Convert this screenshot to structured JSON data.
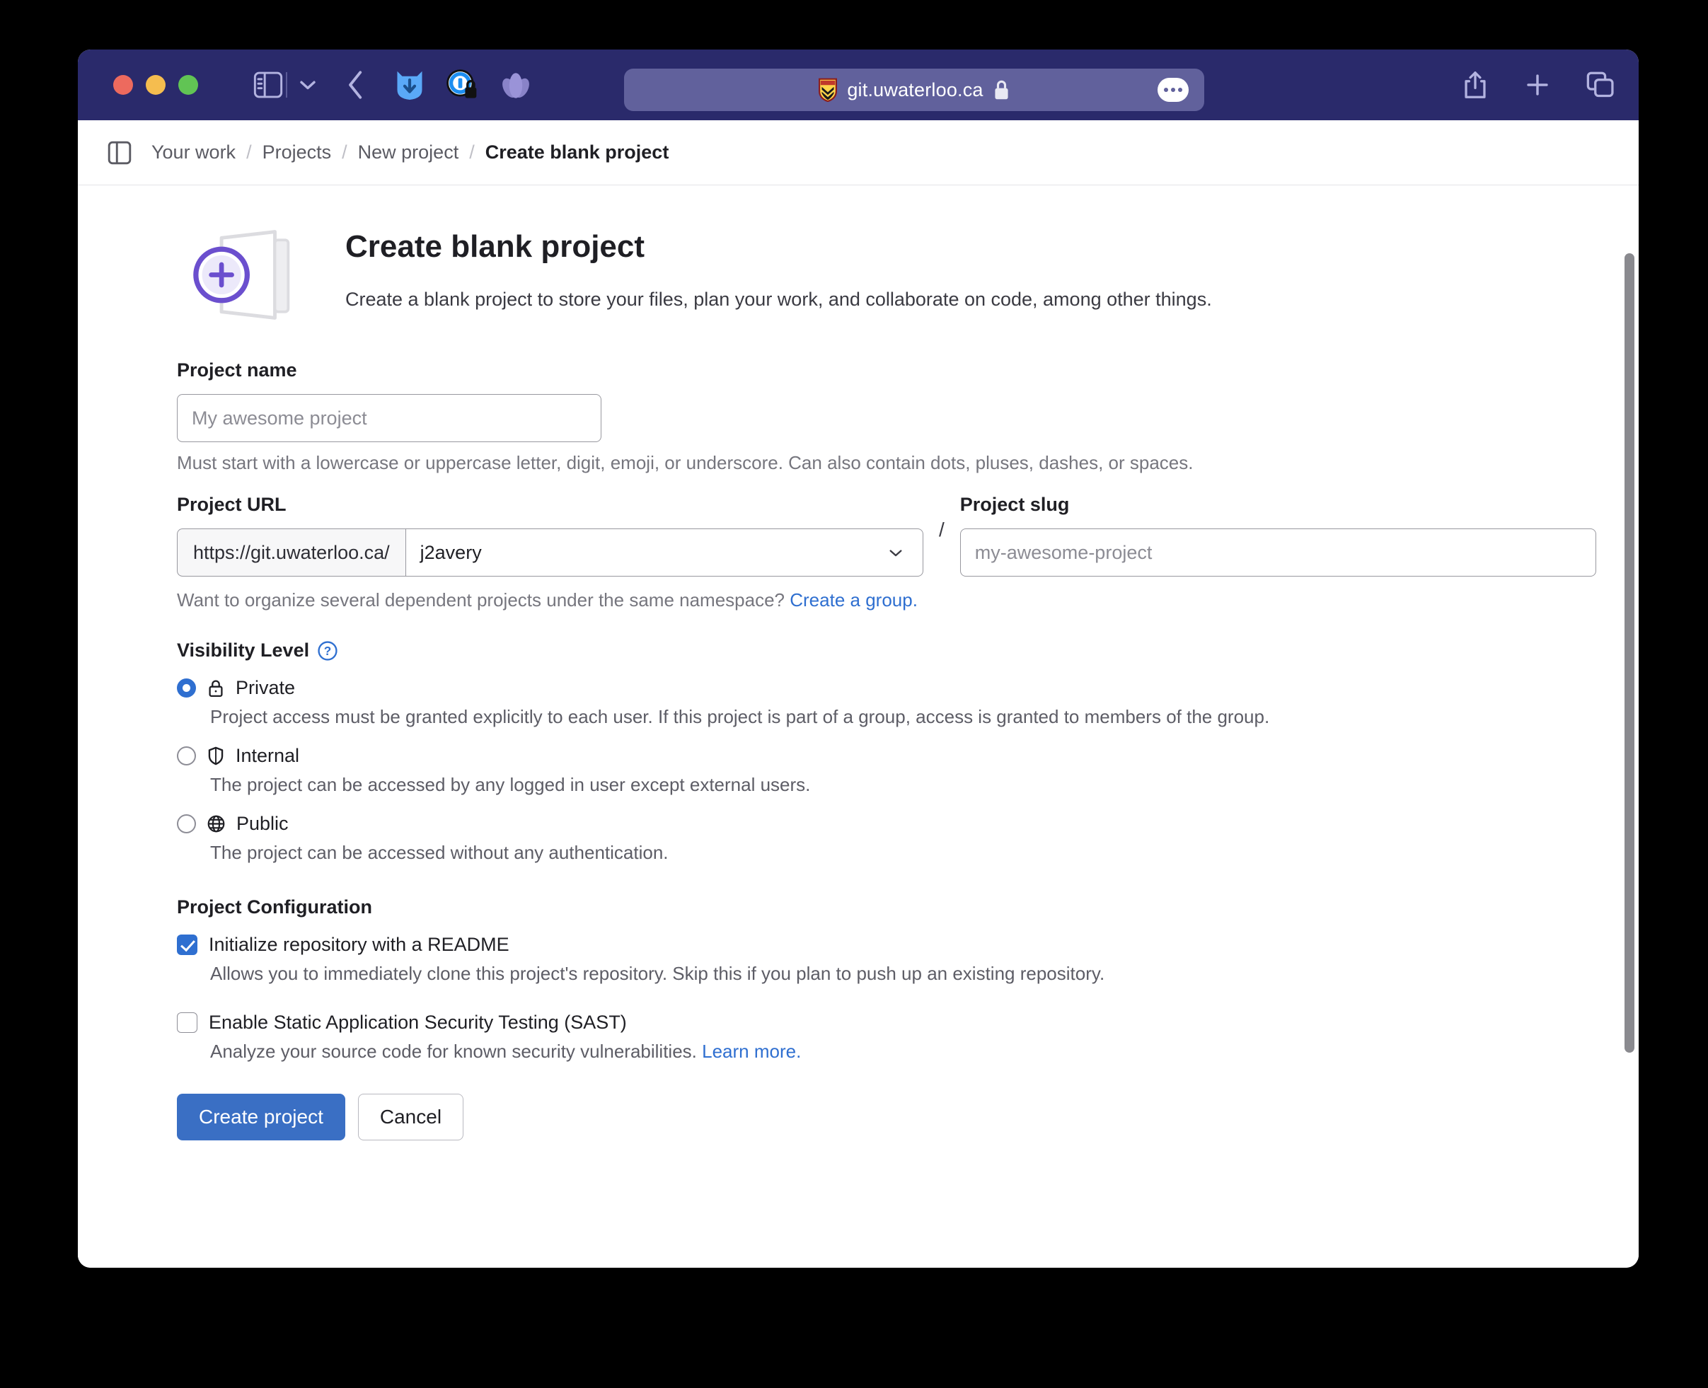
{
  "browser": {
    "url_text": "git.uwaterloo.ca",
    "favicon": "uwaterloo-shield-icon",
    "lock": "lock-icon",
    "traffic_lights": [
      "close-red",
      "minimize-yellow",
      "maximize-green"
    ],
    "toolbar_icons": [
      "sidebar-toggle-icon",
      "chevron-down-icon",
      "back-icon",
      "video-downloader-extension-icon",
      "privacy-extension-icon",
      "flower-extension-icon"
    ],
    "right_icons": [
      "share-icon",
      "new-tab-icon",
      "tab-overview-icon"
    ],
    "more_button": "page-menu-icon"
  },
  "breadcrumb": {
    "sidebar_toggle": "sidebar-panel-icon",
    "items": [
      {
        "label": "Your work",
        "current": false
      },
      {
        "label": "Projects",
        "current": false
      },
      {
        "label": "New project",
        "current": false
      },
      {
        "label": "Create blank project",
        "current": true
      }
    ],
    "separator": "/"
  },
  "header": {
    "icon": "new-project-folder-plus-icon",
    "title": "Create blank project",
    "subtitle": "Create a blank project to store your files, plan your work, and collaborate on code, among other things."
  },
  "form": {
    "project_name": {
      "label": "Project name",
      "value": "",
      "placeholder": "My awesome project",
      "help": "Must start with a lowercase or uppercase letter, digit, emoji, or underscore. Can also contain dots, pluses, dashes, or spaces."
    },
    "project_url": {
      "label": "Project URL",
      "prefix": "https://git.uwaterloo.ca/",
      "namespace_selected": "j2avery",
      "namespace_options": [
        "j2avery"
      ]
    },
    "separator": "/",
    "project_slug": {
      "label": "Project slug",
      "value": "",
      "placeholder": "my-awesome-project"
    },
    "namespace_help": {
      "text": "Want to organize several dependent projects under the same namespace?",
      "link": "Create a group."
    },
    "visibility": {
      "label": "Visibility Level",
      "help_icon": "question-circle-icon",
      "selected": "private",
      "options": [
        {
          "id": "private",
          "icon": "lock-icon",
          "label": "Private",
          "description": "Project access must be granted explicitly to each user. If this project is part of a group, access is granted to members of the group.",
          "checked": true
        },
        {
          "id": "internal",
          "icon": "shield-icon",
          "label": "Internal",
          "description": "The project can be accessed by any logged in user except external users.",
          "checked": false
        },
        {
          "id": "public",
          "icon": "globe-icon",
          "label": "Public",
          "description": "The project can be accessed without any authentication.",
          "checked": false
        }
      ]
    },
    "configuration": {
      "label": "Project Configuration",
      "options": [
        {
          "id": "readme",
          "label": "Initialize repository with a README",
          "description": "Allows you to immediately clone this project's repository. Skip this if you plan to push up an existing repository.",
          "checked": true,
          "link": ""
        },
        {
          "id": "sast",
          "label": "Enable Static Application Security Testing (SAST)",
          "description": "Analyze your source code for known security vulnerabilities.",
          "checked": false,
          "link": "Learn more."
        }
      ]
    },
    "actions": {
      "submit": "Create project",
      "cancel": "Cancel"
    }
  },
  "colors": {
    "toolbar_bg": "#2a2a6b",
    "urlbar_bg": "#61619c",
    "primary_button": "#3a6fc4",
    "link": "#2f6fd0",
    "accent_purple": "#6b4fce"
  }
}
